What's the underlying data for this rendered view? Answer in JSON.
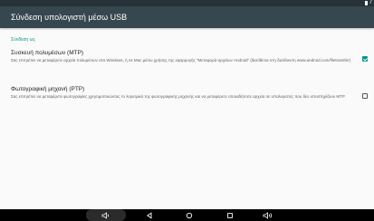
{
  "status_bar": {
    "battery_icon": "battery-icon",
    "clock": "7"
  },
  "action_bar": {
    "title": "Σύνδεση υπολογιστή μέσω USB"
  },
  "settings": {
    "section_header": "Σύνδεση ως",
    "options": [
      {
        "title": "Συσκευή πολυμέσων (MTP)",
        "summary": "Σας επιτρέπει να μεταφέρετε αρχεία πολυμέσων στα Windows, ή σε Mac μέσω χρήσης της εφαρμογής \"Μεταφορά αρχείων Android\" (διατίθεται στη διεύθυνση www.android.com/filetransfer)",
        "checked": true
      },
      {
        "title": "Φωτογραφική μηχανή (PTP)",
        "summary": "Σας επιτρέπει να μεταφέρετε φωτογραφίες χρησιμοποιώντας το λογισμικό της φωτογραφικής μηχανής και να μεταφέρετε οποιαδήποτε αρχεία σε υπολογιστές που δεν υποστηρίζουν MTP",
        "checked": false
      }
    ]
  },
  "nav_bar": {
    "icons": [
      "volume-down-icon",
      "back-icon",
      "home-icon",
      "recent-apps-icon",
      "volume-up-icon"
    ]
  },
  "colors": {
    "status_bar": "#263238",
    "action_bar": "#37474f",
    "accent": "#009688",
    "background": "#fafafa",
    "nav_bar": "#000000"
  }
}
